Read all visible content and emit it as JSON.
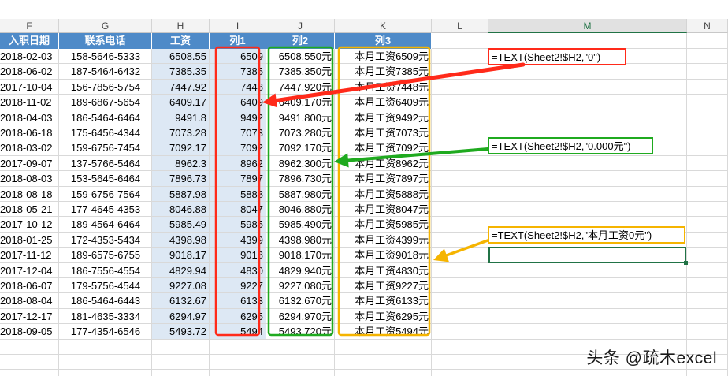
{
  "column_letters": [
    "F",
    "G",
    "H",
    "I",
    "J",
    "K",
    "L",
    "M",
    "N"
  ],
  "selected_column": "M",
  "headers": [
    "入职日期",
    "联系电话",
    "工资",
    "列1",
    "列2",
    "列3"
  ],
  "rows": [
    [
      "2018-02-03",
      "158-5646-5333",
      "6508.55",
      "6509",
      "6508.550元",
      "本月工资6509元"
    ],
    [
      "2018-06-02",
      "187-5464-6432",
      "7385.35",
      "7385",
      "7385.350元",
      "本月工资7385元"
    ],
    [
      "2017-10-04",
      "156-7856-5754",
      "7447.92",
      "7448",
      "7447.920元",
      "本月工资7448元"
    ],
    [
      "2018-11-02",
      "189-6867-5654",
      "6409.17",
      "6409",
      "6409.170元",
      "本月工资6409元"
    ],
    [
      "2018-04-03",
      "186-5464-6464",
      "9491.8",
      "9492",
      "9491.800元",
      "本月工资9492元"
    ],
    [
      "2018-06-18",
      "175-6456-4344",
      "7073.28",
      "7073",
      "7073.280元",
      "本月工资7073元"
    ],
    [
      "2018-03-02",
      "159-6756-7454",
      "7092.17",
      "7092",
      "7092.170元",
      "本月工资7092元"
    ],
    [
      "2017-09-07",
      "137-5766-5464",
      "8962.3",
      "8962",
      "8962.300元",
      "本月工资8962元"
    ],
    [
      "2018-08-03",
      "153-5645-6464",
      "7896.73",
      "7897",
      "7896.730元",
      "本月工资7897元"
    ],
    [
      "2018-08-18",
      "159-6756-7564",
      "5887.98",
      "5888",
      "5887.980元",
      "本月工资5888元"
    ],
    [
      "2018-05-21",
      "177-4645-4353",
      "8046.88",
      "8047",
      "8046.880元",
      "本月工资8047元"
    ],
    [
      "2017-10-12",
      "189-4564-6464",
      "5985.49",
      "5985",
      "5985.490元",
      "本月工资5985元"
    ],
    [
      "2018-01-25",
      "172-4353-5434",
      "4398.98",
      "4399",
      "4398.980元",
      "本月工资4399元"
    ],
    [
      "2017-11-12",
      "189-6575-6755",
      "9018.17",
      "9018",
      "9018.170元",
      "本月工资9018元"
    ],
    [
      "2017-12-04",
      "186-7556-4554",
      "4829.94",
      "4830",
      "4829.940元",
      "本月工资4830元"
    ],
    [
      "2018-06-07",
      "179-5756-4544",
      "9227.08",
      "9227",
      "9227.080元",
      "本月工资9227元"
    ],
    [
      "2018-08-04",
      "186-5464-6443",
      "6132.67",
      "6133",
      "6132.670元",
      "本月工资6133元"
    ],
    [
      "2017-12-17",
      "181-4635-3334",
      "6294.97",
      "6295",
      "6294.970元",
      "本月工资6295元"
    ],
    [
      "2018-09-05",
      "177-4354-6546",
      "5493.72",
      "5494",
      "5493.720元",
      "本月工资5494元"
    ]
  ],
  "formulas": [
    {
      "text": "=TEXT(Sheet2!$H2,\"0\")",
      "color": "#ff2a1a"
    },
    {
      "text": "=TEXT(Sheet2!$H2,\"0.000元\")",
      "color": "#1faa1f"
    },
    {
      "text": "=TEXT(Sheet2!$H2,\"本月工资0元\")",
      "color": "#f5b400"
    }
  ],
  "colors": {
    "header_fill": "#4e8ac8",
    "band_fill": "#dde8f4",
    "red": "#ff2a1a",
    "green": "#1faa1f",
    "orange": "#f5b400",
    "excel_green": "#217346"
  },
  "watermark": "头条 @疏木excel"
}
